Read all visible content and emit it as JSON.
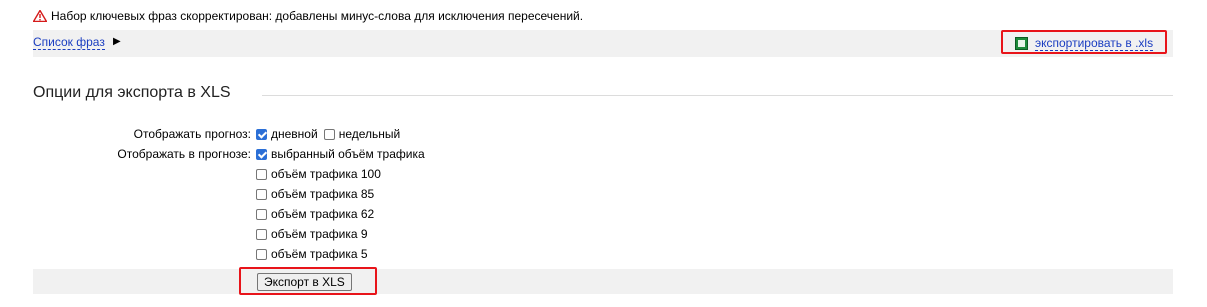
{
  "warning": {
    "icon": "warning-triangle-icon",
    "text": "Набор ключевых фраз скорректирован: добавлены минус-слова для исключения пересечений."
  },
  "phrase_bar": {
    "phrase_list_link": "Список фраз",
    "arrow": "▶",
    "export_link": "экспортировать в .xls",
    "export_icon": "excel-file-icon",
    "highlight_color": "#e8141a"
  },
  "section": {
    "title": "Опции для экспорта в XLS"
  },
  "forecast": {
    "label": "Отображать прогноз:",
    "options": [
      {
        "label": "дневной",
        "checked": true
      },
      {
        "label": "недельный",
        "checked": false
      }
    ]
  },
  "forecast_display": {
    "label": "Отображать в прогнозе:",
    "options": [
      {
        "label": "выбранный объём трафика",
        "checked": true
      },
      {
        "label": "объём трафика 100",
        "checked": false
      },
      {
        "label": "объём трафика 85",
        "checked": false
      },
      {
        "label": "объём трафика 62",
        "checked": false
      },
      {
        "label": "объём трафика 9",
        "checked": false
      },
      {
        "label": "объём трафика 5",
        "checked": false
      }
    ]
  },
  "export_button": {
    "label": "Экспорт в XLS"
  },
  "colors": {
    "link": "#1a3dc1",
    "checkbox_checked": "#2b6fd6",
    "bar_bg": "#f1f1f1"
  }
}
